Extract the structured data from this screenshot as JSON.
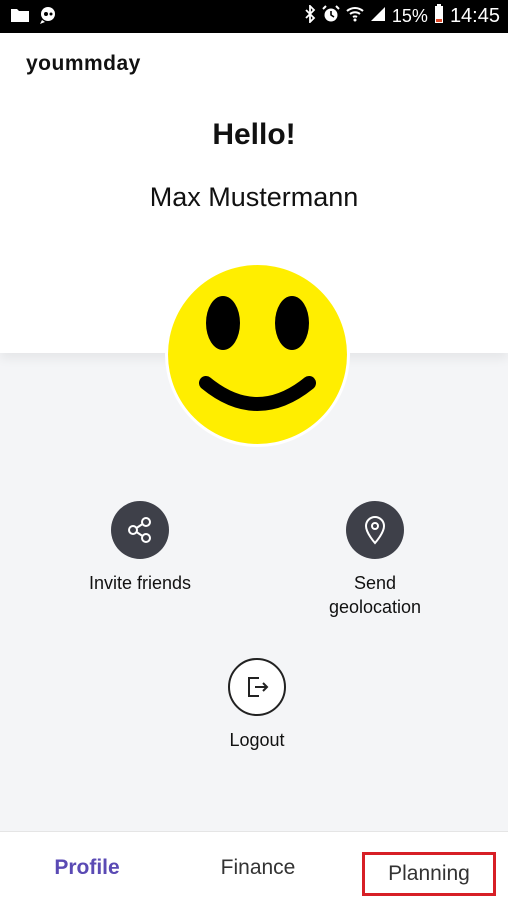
{
  "status_bar": {
    "battery_percent": "15%",
    "time": "14:45"
  },
  "header": {
    "brand": "yoummday",
    "greeting": "Hello!",
    "user_name": "Max Mustermann"
  },
  "avatar": {
    "icon": "smiley-face-icon",
    "color": "#ffee00"
  },
  "actions": {
    "invite": {
      "label": "Invite friends",
      "icon": "share-icon"
    },
    "geo": {
      "label_line1": "Send",
      "label_line2": "geolocation",
      "icon": "map-pin-icon"
    },
    "logout": {
      "label": "Logout",
      "icon": "logout-icon"
    }
  },
  "bottom_nav": {
    "items": [
      {
        "label": "Profile",
        "active": true
      },
      {
        "label": "Finance",
        "active": false
      },
      {
        "label": "Planning",
        "active": false
      }
    ],
    "accent_color": "#5a4ab4",
    "highlight_color": "#d71f26"
  }
}
